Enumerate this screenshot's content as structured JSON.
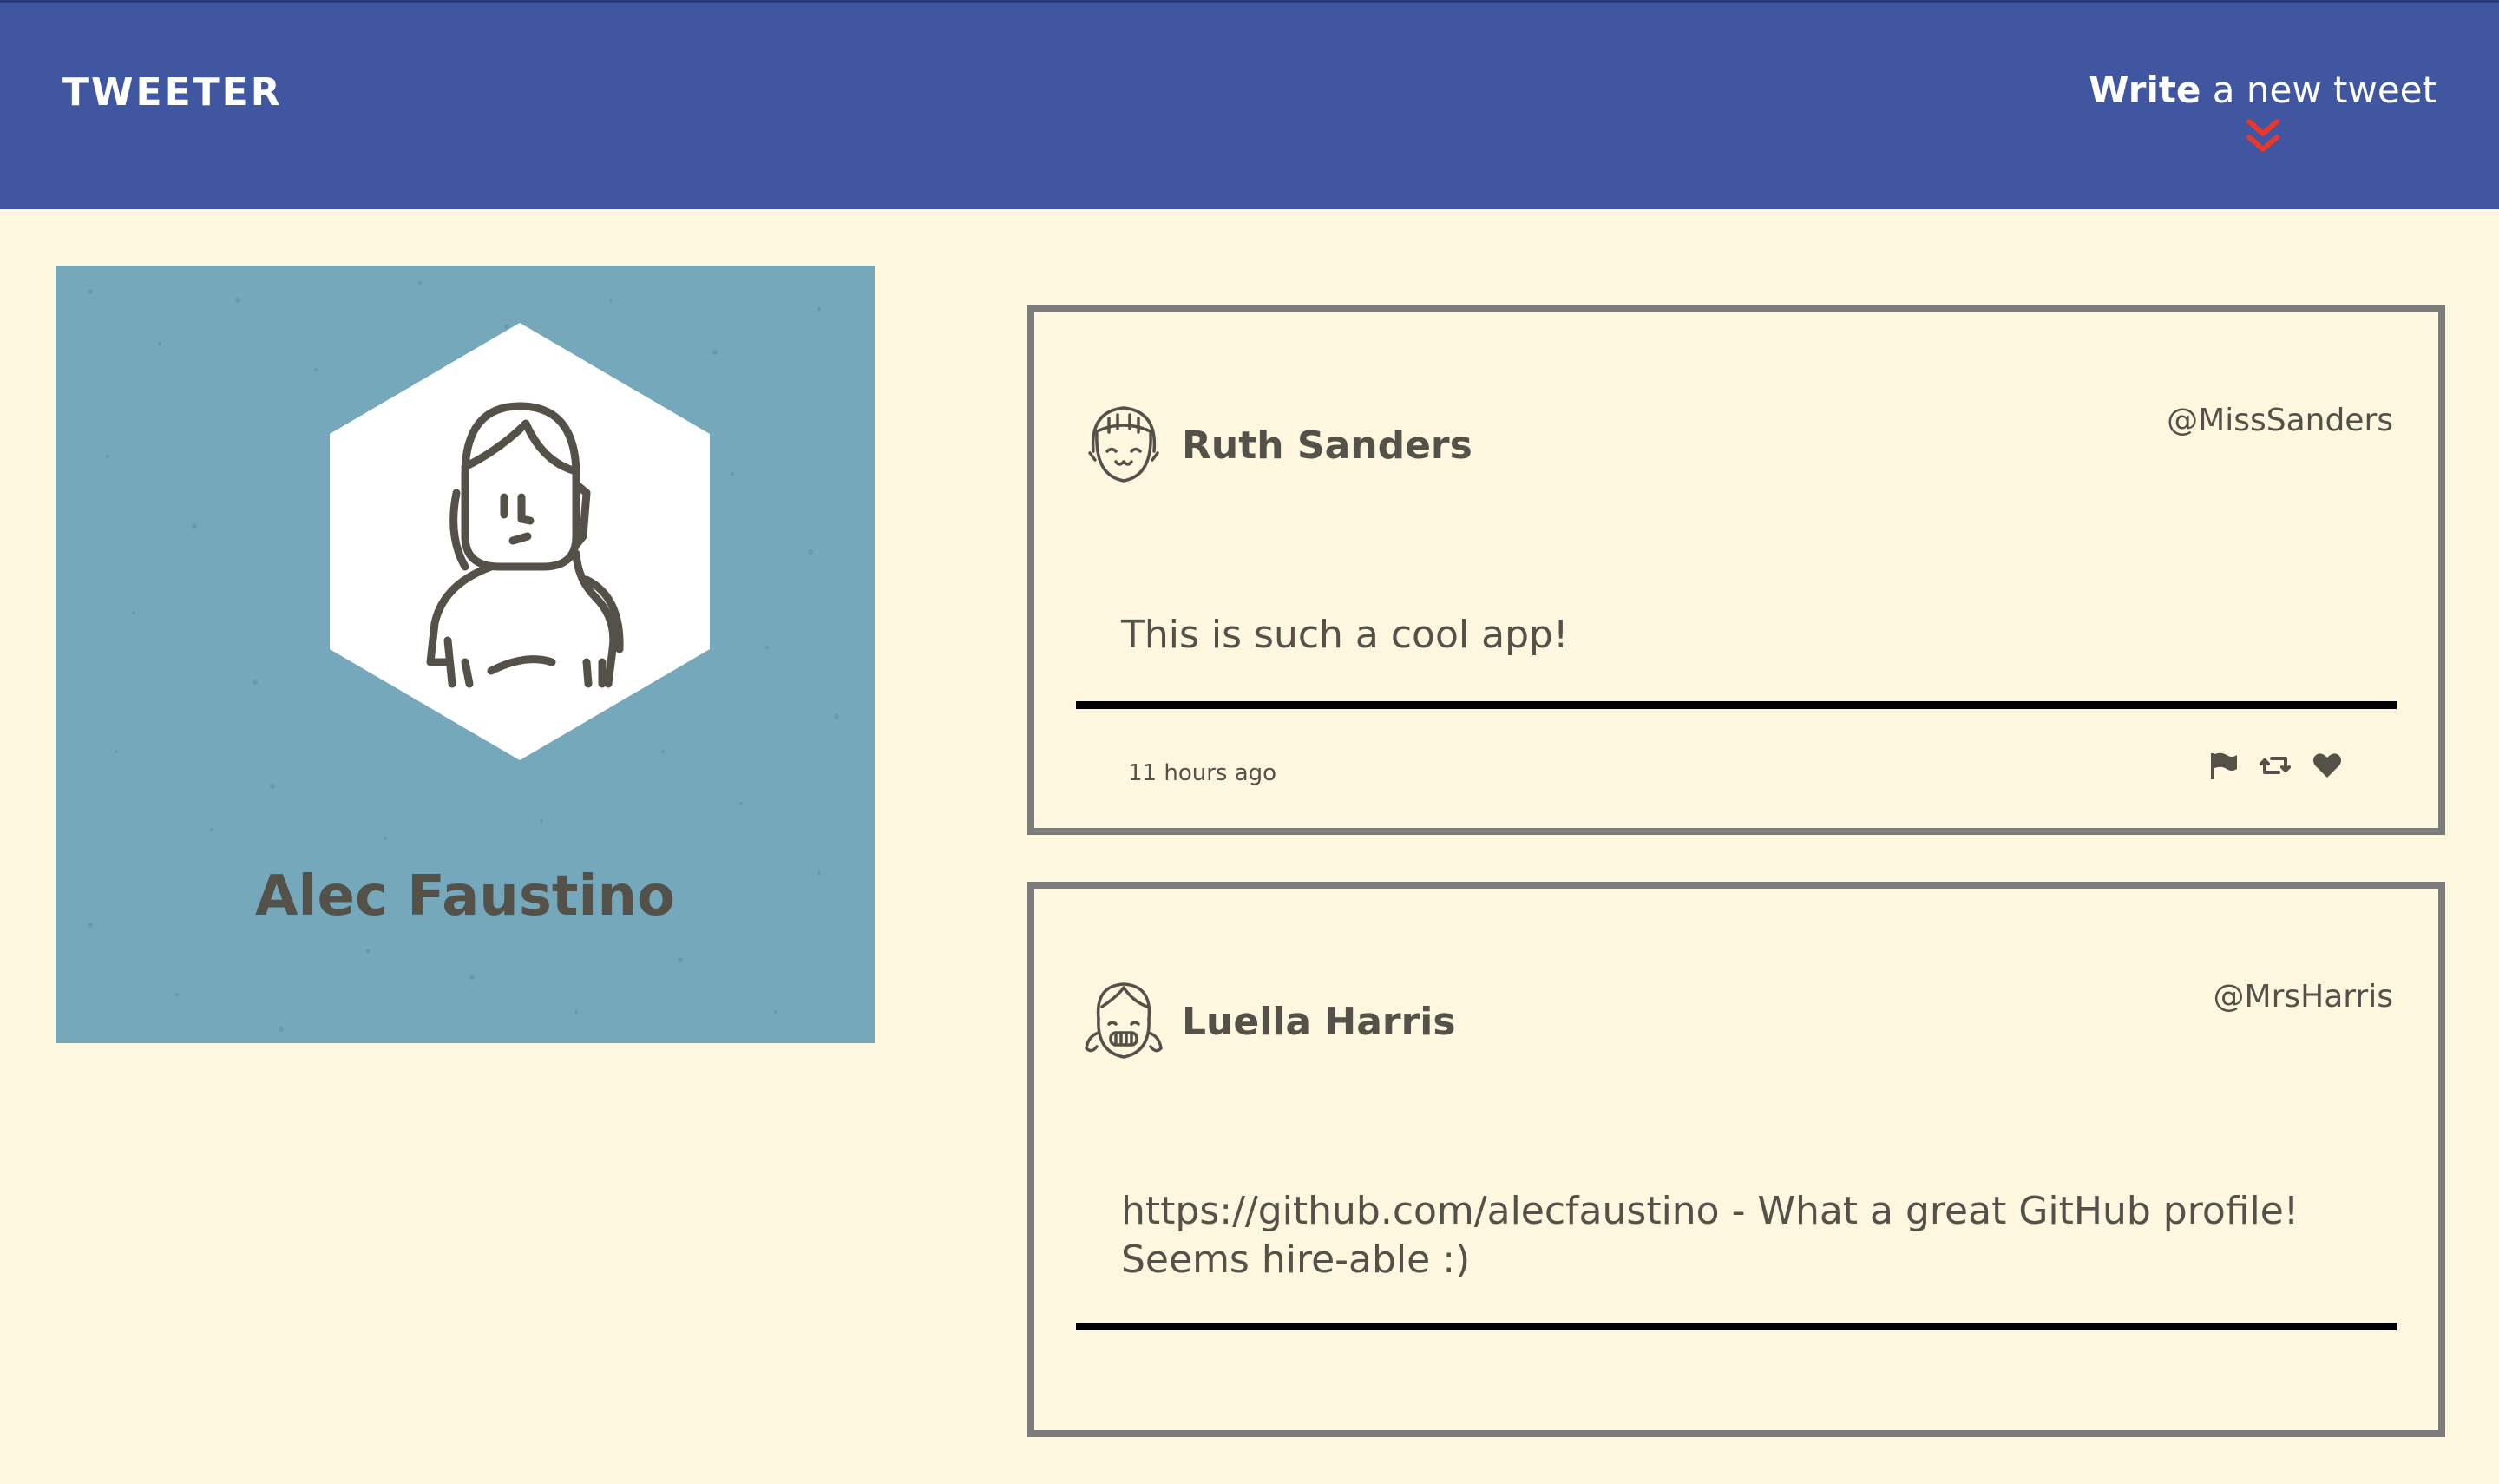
{
  "nav": {
    "brand": "TWEETER",
    "compose_strong": "Write",
    "compose_rest": " a new tweet",
    "accent_color": "#e8382c",
    "background_color": "#4056a0"
  },
  "profile": {
    "name": "Alec Faustino",
    "avatar_icon": "girl-avatar-icon",
    "background_color": "#76a8bc"
  },
  "tweets": [
    {
      "name": "Ruth Sanders",
      "handle": "@MissSanders",
      "text": "This is such a cool app!",
      "time": "11 hours ago",
      "avatar_icon": "smiling-girl-avatar-icon"
    },
    {
      "name": "Luella Harris",
      "handle": "@MrsHarris",
      "text": "https://github.com/alecfaustino - What a great GitHub profile! Seems hire-able :)",
      "avatar_icon": "pigtails-girl-avatar-icon"
    }
  ],
  "actions": [
    "flag-icon",
    "retweet-icon",
    "heart-icon"
  ]
}
